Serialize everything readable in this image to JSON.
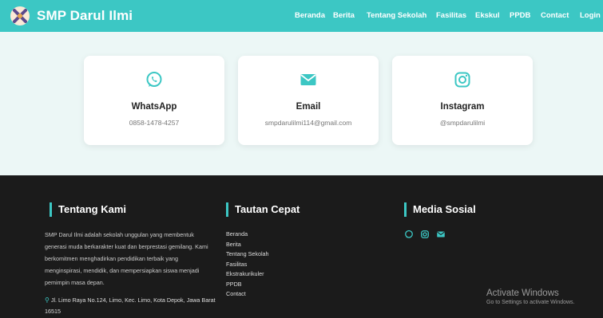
{
  "navbar": {
    "brand": "SMP Darul Ilmi",
    "links": [
      "Beranda",
      "Berita",
      "Tentang Sekolah",
      "Fasilitas",
      "Ekskul",
      "PPDB",
      "Contact",
      "Login"
    ]
  },
  "contact": {
    "whatsapp": {
      "title": "WhatsApp",
      "value": "0858-1478-4257",
      "icon": "whatsapp-icon"
    },
    "email": {
      "title": "Email",
      "value": "smpdarulilmi114@gmail.com",
      "icon": "envelope-icon"
    },
    "instagram": {
      "title": "Instagram",
      "value": "@smpdarulilmi",
      "icon": "instagram-icon"
    }
  },
  "footer": {
    "about": {
      "heading": "Tentang Kami",
      "text": "SMP Darul Ilmi adalah sekolah unggulan yang membentuk generasi muda berkarakter kuat dan berprestasi gemilang. Kami berkomitmen menghadirkan pendidikan terbaik yang menginspirasi, mendidik, dan mempersiapkan siswa menjadi pemimpin masa depan.",
      "address": "Jl. Limo Raya No.124, Limo, Kec. Limo, Kota Depok, Jawa Barat 16515"
    },
    "links": {
      "heading": "Tautan Cepat",
      "items": [
        "Beranda",
        "Berita",
        "Tentang Sekolah",
        "Fasilitas",
        "Ekstrakurikuler",
        "PPDB",
        "Contact"
      ]
    },
    "social": {
      "heading": "Media Sosial"
    }
  },
  "watermark": {
    "title": "Activate Windows",
    "subtitle": "Go to Settings to activate Windows."
  },
  "colors": {
    "accent": "#3cc7c4",
    "footer_bg": "#1b1b1b",
    "page_bg": "#ecf7f6"
  }
}
